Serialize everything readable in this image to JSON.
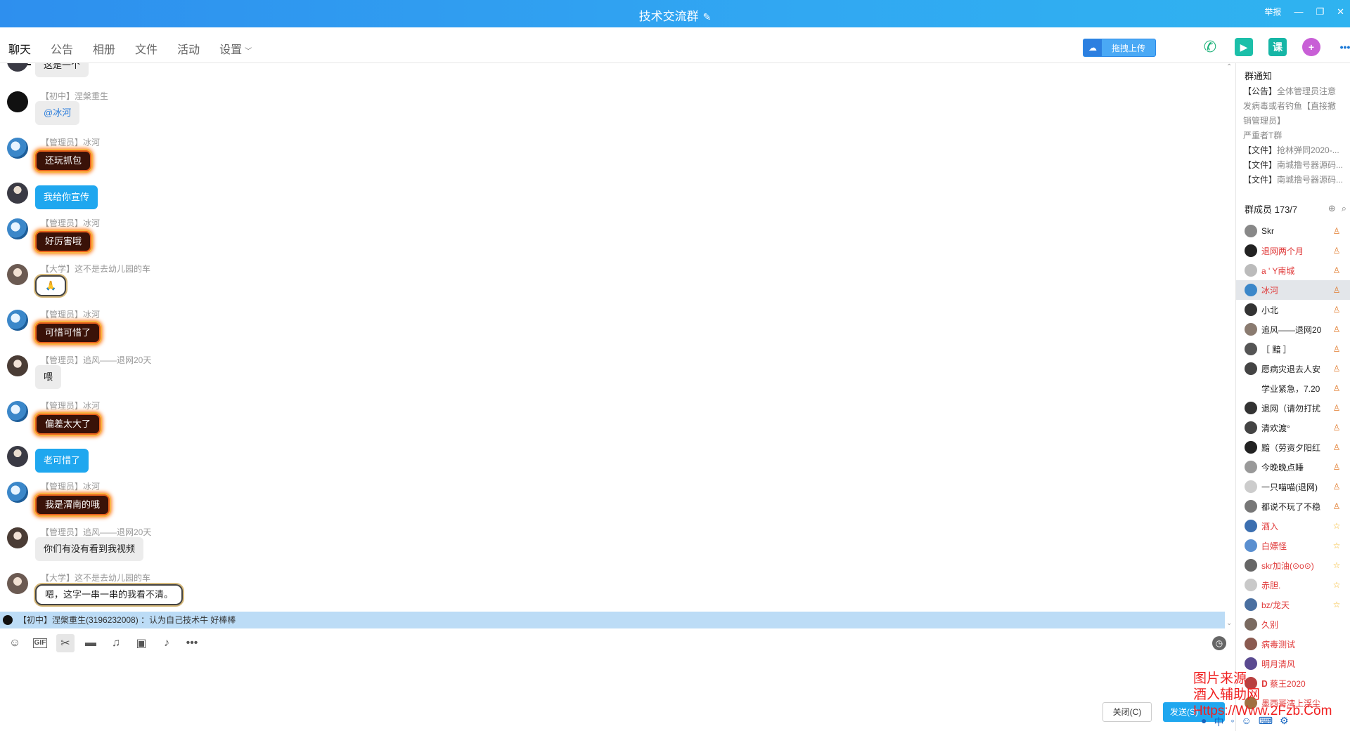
{
  "window": {
    "title": "技术交流群",
    "report_label": "举报",
    "minimize_label": "—",
    "restore_label": "❐",
    "close_label": "✕"
  },
  "tabs": [
    {
      "label": "聊天",
      "active": true
    },
    {
      "label": "公告",
      "active": false
    },
    {
      "label": "相册",
      "active": false
    },
    {
      "label": "文件",
      "active": false
    },
    {
      "label": "活动",
      "active": false
    },
    {
      "label": "设置",
      "active": false
    }
  ],
  "upload": {
    "label": "拖拽上传"
  },
  "toolbar_icons": {
    "course_label": "课",
    "more_label": "•••"
  },
  "messages": [
    {
      "sender": "",
      "text": "这是一个"
    },
    {
      "sender": "【初中】涅槃重生",
      "text": "@冰河"
    },
    {
      "sender": "【管理员】冰河",
      "text": "还玩抓包"
    },
    {
      "sender": "",
      "text": "我给你宣传"
    },
    {
      "sender": "【管理员】冰河",
      "text": "好厉害哦"
    },
    {
      "sender": "【大学】这不是去幼儿园的车",
      "text": "🙏"
    },
    {
      "sender": "【管理员】冰河",
      "text": "可惜可惜了"
    },
    {
      "sender": "【管理员】追风——退网20天",
      "text": "喂"
    },
    {
      "sender": "【管理员】冰河",
      "text": "偏差太大了"
    },
    {
      "sender": "",
      "text": "老可惜了"
    },
    {
      "sender": "【管理员】冰河",
      "text": "我是渭南的哦"
    },
    {
      "sender": "【管理员】追风——退网20天",
      "text": "你们有没有看到我视频"
    },
    {
      "sender": "【大学】这不是去幼儿园的车",
      "text": "嗯，这字一串一串的我看不清。"
    }
  ],
  "notice_strip": "【初中】涅槃重生(3196232008) ：认为自己技术牛  好棒棒",
  "input_toolbar": {
    "gif_label": "GIF",
    "more_label": "•••"
  },
  "buttons": {
    "close": "关闭(C)",
    "send": "发送(S)"
  },
  "sidebar": {
    "notice_title": "群通知",
    "notice_lines": [
      {
        "prefix": "【公告】",
        "text": "全体管理员注意"
      },
      {
        "prefix": "",
        "text": "发病毒或者钓鱼【直接撤"
      },
      {
        "prefix": "",
        "text": "销管理员】"
      },
      {
        "prefix": "",
        "text": "严重者T群"
      },
      {
        "prefix": "【文件】",
        "text": "抢林弹同2020-..."
      },
      {
        "prefix": "【文件】",
        "text": "南城撸号器源码..."
      },
      {
        "prefix": "【文件】",
        "text": "南城撸号器源码..."
      }
    ],
    "members_title": "群成员 173/7",
    "members": [
      {
        "name": "Skr",
        "color": "black",
        "badge": "user"
      },
      {
        "name": "退网两个月",
        "color": "red",
        "badge": "user"
      },
      {
        "name": "a ' Y南城",
        "color": "red",
        "badge": "user"
      },
      {
        "name": "冰河",
        "color": "red",
        "badge": "user",
        "selected": true
      },
      {
        "name": "小北",
        "color": "black",
        "badge": "user"
      },
      {
        "name": "追风——退网20",
        "color": "black",
        "badge": "user"
      },
      {
        "name": "［ 黯 ］",
        "color": "black",
        "badge": "user"
      },
      {
        "name": "愿病灾退去人安",
        "color": "black",
        "badge": "star-user"
      },
      {
        "name": "学业紧急，7.20",
        "color": "black",
        "badge": "user"
      },
      {
        "name": "退网（请勿打扰",
        "color": "black",
        "badge": "user"
      },
      {
        "name": "清欢渡°",
        "color": "black",
        "badge": "user"
      },
      {
        "name": "黯（劳资夕阳红",
        "color": "black",
        "badge": "user"
      },
      {
        "name": "今晚晚点睡",
        "color": "black",
        "badge": "star-user"
      },
      {
        "name": "一只喵喵(退网)",
        "color": "black",
        "badge": "user"
      },
      {
        "name": "都说不玩了不稳",
        "color": "black",
        "badge": "user"
      },
      {
        "name": "酒入",
        "color": "red",
        "badge": "star"
      },
      {
        "name": "白嫖怪",
        "color": "red",
        "badge": "star"
      },
      {
        "name": "skr加油(⊙o⊙)",
        "color": "red",
        "badge": "star"
      },
      {
        "name": "赤胆.",
        "color": "red",
        "badge": "star"
      },
      {
        "name": "bz/龙天",
        "color": "red",
        "badge": "star"
      },
      {
        "name": "久别",
        "color": "red",
        "badge": ""
      },
      {
        "name": "病毒测试",
        "color": "red",
        "badge": ""
      },
      {
        "name": "明月清风",
        "color": "red",
        "badge": ""
      },
      {
        "name": "𝐃 蔡王2020",
        "color": "red",
        "badge": ""
      },
      {
        "name": "墨西哥湾上浮尘",
        "color": "red",
        "badge": ""
      }
    ]
  },
  "watermark": {
    "line1": "图片来源",
    "line2": "酒入辅助网",
    "line3": "Https://Www.2Fzb.Com"
  },
  "tray": {
    "ime_label": "中"
  }
}
